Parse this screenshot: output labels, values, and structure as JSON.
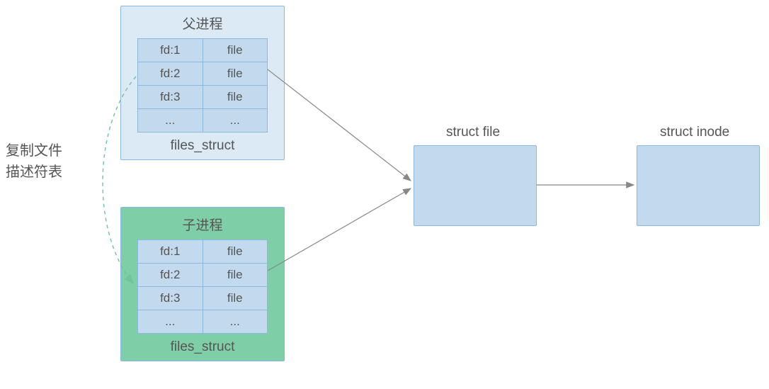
{
  "parent": {
    "title": "父进程",
    "rows": [
      {
        "fd": "fd:1",
        "file": "file"
      },
      {
        "fd": "fd:2",
        "file": "file"
      },
      {
        "fd": "fd:3",
        "file": "file"
      },
      {
        "fd": "...",
        "file": "..."
      }
    ],
    "caption": "files_struct"
  },
  "child": {
    "title": "子进程",
    "rows": [
      {
        "fd": "fd:1",
        "file": "file"
      },
      {
        "fd": "fd:2",
        "file": "file"
      },
      {
        "fd": "fd:3",
        "file": "file"
      },
      {
        "fd": "...",
        "file": "..."
      }
    ],
    "caption": "files_struct"
  },
  "side_label_line1": "复制文件",
  "side_label_line2": "描述符表",
  "struct_file_label": "struct file",
  "struct_inode_label": "struct inode"
}
